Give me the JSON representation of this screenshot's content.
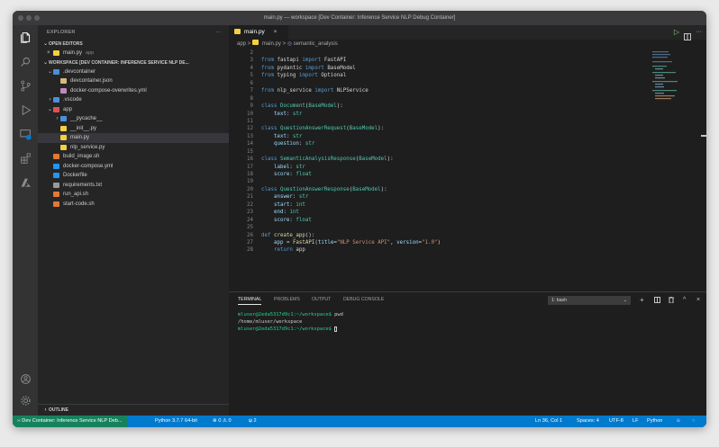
{
  "window": {
    "title": "main.py — workspace [Dev Container: Inference Service NLP Debug Container]"
  },
  "sidebar": {
    "header": "EXPLORER",
    "more": "···",
    "open_editors_label": "OPEN EDITORS",
    "open_editor": {
      "close": "×",
      "name": "main.py",
      "folder": "app"
    },
    "workspace_label": "WORKSPACE [DEV CONTAINER: INFERENCE SERVICE NLP DE...",
    "tree": [
      {
        "label": ".devcontainer",
        "indent": 1,
        "chev": "v",
        "icon": "folder",
        "color": "#4a90d9"
      },
      {
        "label": "devcontainer.json",
        "indent": 2,
        "chev": "",
        "icon": "json",
        "color": "#d7ba7d"
      },
      {
        "label": "docker-compose-overwrites.yml",
        "indent": 2,
        "chev": "",
        "icon": "yml",
        "color": "#c586c0"
      },
      {
        "label": ".vscode",
        "indent": 1,
        "chev": ">",
        "icon": "folder",
        "color": "#4a90d9"
      },
      {
        "label": "app",
        "indent": 1,
        "chev": "v",
        "icon": "folder",
        "color": "#e05252"
      },
      {
        "label": "__pycache__",
        "indent": 2,
        "chev": ">",
        "icon": "folder",
        "color": "#4a90d9"
      },
      {
        "label": "__init__.py",
        "indent": 2,
        "chev": "",
        "icon": "python",
        "color": "#f4d03f"
      },
      {
        "label": "main.py",
        "indent": 2,
        "chev": "",
        "icon": "python",
        "color": "#f4d03f",
        "selected": true
      },
      {
        "label": "nlp_service.py",
        "indent": 2,
        "chev": "",
        "icon": "python",
        "color": "#f4d03f"
      },
      {
        "label": "build_image.sh",
        "indent": 1,
        "chev": "",
        "icon": "shell",
        "color": "#e37933"
      },
      {
        "label": "docker-compose.yml",
        "indent": 1,
        "chev": "",
        "icon": "docker",
        "color": "#2496ed"
      },
      {
        "label": "Dockerfile",
        "indent": 1,
        "chev": "",
        "icon": "docker",
        "color": "#2496ed"
      },
      {
        "label": "requirements.txt",
        "indent": 1,
        "chev": "",
        "icon": "text",
        "color": "#9a9a9a"
      },
      {
        "label": "run_api.sh",
        "indent": 1,
        "chev": "",
        "icon": "shell",
        "color": "#e37933"
      },
      {
        "label": "start-code.sh",
        "indent": 1,
        "chev": "",
        "icon": "shell",
        "color": "#e37933"
      }
    ],
    "outline_label": "OUTLINE"
  },
  "editor": {
    "tab": {
      "name": "main.py",
      "close": "×"
    },
    "breadcrumb": {
      "folder": "app",
      "sep": ">",
      "file": "main.py",
      "symbol": "semantic_analysis"
    },
    "lines": [
      {
        "n": "2",
        "tokens": []
      },
      {
        "n": "3",
        "tokens": [
          [
            "kw",
            "from "
          ],
          [
            "plain",
            "fastapi "
          ],
          [
            "kw",
            "import "
          ],
          [
            "plain",
            "FastAPI"
          ]
        ]
      },
      {
        "n": "4",
        "tokens": [
          [
            "kw",
            "from "
          ],
          [
            "plain",
            "pydantic "
          ],
          [
            "kw",
            "import "
          ],
          [
            "plain",
            "BaseModel"
          ]
        ]
      },
      {
        "n": "5",
        "tokens": [
          [
            "kw",
            "from "
          ],
          [
            "plain",
            "typing "
          ],
          [
            "kw",
            "import "
          ],
          [
            "plain",
            "Optional"
          ]
        ]
      },
      {
        "n": "6",
        "tokens": []
      },
      {
        "n": "7",
        "tokens": [
          [
            "kw",
            "from "
          ],
          [
            "plain",
            "nlp_service "
          ],
          [
            "kw",
            "import "
          ],
          [
            "plain",
            "NLPService"
          ]
        ]
      },
      {
        "n": "8",
        "tokens": []
      },
      {
        "n": "9",
        "tokens": [
          [
            "kw",
            "class "
          ],
          [
            "typ",
            "Document"
          ],
          [
            "plain",
            "("
          ],
          [
            "typ",
            "BaseModel"
          ],
          [
            "plain",
            "):"
          ]
        ]
      },
      {
        "n": "10",
        "tokens": [
          [
            "plain",
            "    "
          ],
          [
            "param",
            "text"
          ],
          [
            "plain",
            ": "
          ],
          [
            "typ",
            "str"
          ]
        ]
      },
      {
        "n": "11",
        "tokens": []
      },
      {
        "n": "12",
        "tokens": [
          [
            "kw",
            "class "
          ],
          [
            "typ",
            "QuestionAnswerRequest"
          ],
          [
            "plain",
            "("
          ],
          [
            "typ",
            "BaseModel"
          ],
          [
            "plain",
            "):"
          ]
        ]
      },
      {
        "n": "13",
        "tokens": [
          [
            "plain",
            "    "
          ],
          [
            "param",
            "text"
          ],
          [
            "plain",
            ": "
          ],
          [
            "typ",
            "str"
          ]
        ]
      },
      {
        "n": "14",
        "tokens": [
          [
            "plain",
            "    "
          ],
          [
            "param",
            "question"
          ],
          [
            "plain",
            ": "
          ],
          [
            "typ",
            "str"
          ]
        ]
      },
      {
        "n": "15",
        "tokens": []
      },
      {
        "n": "16",
        "tokens": [
          [
            "kw",
            "class "
          ],
          [
            "typ",
            "SemanticAnalysisResponse"
          ],
          [
            "plain",
            "("
          ],
          [
            "typ",
            "BaseModel"
          ],
          [
            "plain",
            "):"
          ]
        ]
      },
      {
        "n": "17",
        "tokens": [
          [
            "plain",
            "    "
          ],
          [
            "param",
            "label"
          ],
          [
            "plain",
            ": "
          ],
          [
            "typ",
            "str"
          ]
        ]
      },
      {
        "n": "18",
        "tokens": [
          [
            "plain",
            "    "
          ],
          [
            "param",
            "score"
          ],
          [
            "plain",
            ": "
          ],
          [
            "typ",
            "float"
          ]
        ]
      },
      {
        "n": "19",
        "tokens": []
      },
      {
        "n": "20",
        "tokens": [
          [
            "kw",
            "class "
          ],
          [
            "typ",
            "QuestionAnswerResponse"
          ],
          [
            "plain",
            "("
          ],
          [
            "typ",
            "BaseModel"
          ],
          [
            "plain",
            "):"
          ]
        ]
      },
      {
        "n": "21",
        "tokens": [
          [
            "plain",
            "    "
          ],
          [
            "param",
            "answer"
          ],
          [
            "plain",
            ": "
          ],
          [
            "typ",
            "str"
          ]
        ]
      },
      {
        "n": "22",
        "tokens": [
          [
            "plain",
            "    "
          ],
          [
            "param",
            "start"
          ],
          [
            "plain",
            ": "
          ],
          [
            "typ",
            "int"
          ]
        ]
      },
      {
        "n": "23",
        "tokens": [
          [
            "plain",
            "    "
          ],
          [
            "param",
            "end"
          ],
          [
            "plain",
            ": "
          ],
          [
            "typ",
            "int"
          ]
        ]
      },
      {
        "n": "24",
        "tokens": [
          [
            "plain",
            "    "
          ],
          [
            "param",
            "score"
          ],
          [
            "plain",
            ": "
          ],
          [
            "typ",
            "float"
          ]
        ]
      },
      {
        "n": "25",
        "tokens": []
      },
      {
        "n": "26",
        "tokens": [
          [
            "kw",
            "def "
          ],
          [
            "fn",
            "create_app"
          ],
          [
            "plain",
            "():"
          ]
        ]
      },
      {
        "n": "27",
        "tokens": [
          [
            "plain",
            "    "
          ],
          [
            "param",
            "app"
          ],
          [
            "plain",
            " = "
          ],
          [
            "fn",
            "FastAPI"
          ],
          [
            "plain",
            "("
          ],
          [
            "param",
            "title"
          ],
          [
            "plain",
            "="
          ],
          [
            "str",
            "\"NLP Service API\""
          ],
          [
            "plain",
            ", "
          ],
          [
            "param",
            "version"
          ],
          [
            "plain",
            "="
          ],
          [
            "str",
            "\"1.0\""
          ],
          [
            "plain",
            ")"
          ]
        ]
      },
      {
        "n": "28",
        "tokens": [
          [
            "plain",
            "    "
          ],
          [
            "kw",
            "return "
          ],
          [
            "plain",
            "app"
          ]
        ]
      }
    ]
  },
  "panel": {
    "tabs": [
      "TERMINAL",
      "PROBLEMS",
      "OUTPUT",
      "DEBUG CONSOLE"
    ],
    "shell_select": "1: bash",
    "terminal": [
      {
        "prompt": "mluser@2eda5317d9c1:~/workspace$",
        "cmd": " pwd"
      },
      {
        "output": "/home/mluser/workspace"
      },
      {
        "prompt": "mluser@2eda5317d9c1:~/workspace$",
        "cmd": " ",
        "cursor": true
      }
    ]
  },
  "statusbar": {
    "remote": "Dev Container: Inference Service NLP Deb...",
    "python": "Python 3.7.7 64-bit",
    "problems": "⊗ 0 ⚠ 0",
    "ports": "ψ 2",
    "position": "Ln 36, Col 1",
    "spaces": "Spaces: 4",
    "encoding": "UTF-8",
    "eol": "LF",
    "language": "Python"
  },
  "colors": {
    "accent": "#007acc",
    "remote": "#16825d",
    "selection": "#37373d"
  }
}
